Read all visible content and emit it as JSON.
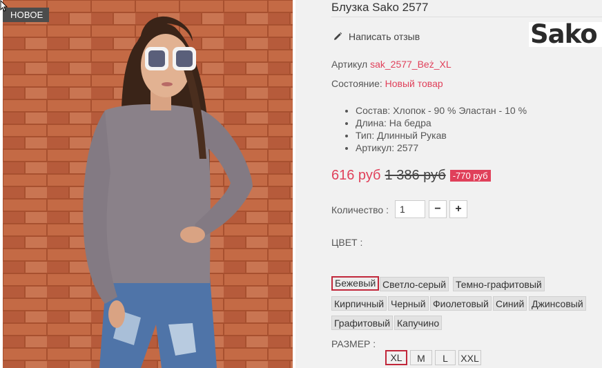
{
  "product": {
    "badge": "НОВОЕ",
    "title": "Блузка Sako 2577",
    "review_label": "Написать отзыв",
    "brand_logo_text": "Sako",
    "sku_label": "Артикул",
    "sku_value": "sak_2577_Beż_XL",
    "condition_label": "Состояние:",
    "condition_value": "Новый товар",
    "features": [
      "Состав: Хлопок - 90 % Эластан - 10 %",
      "Длина: На бедра",
      "Тип: Длинный Рукав",
      "Артикул: 2577"
    ],
    "price_new": "616 руб",
    "price_old": "1 386 руб",
    "discount": "-770 руб",
    "quantity_label": "Количество :",
    "quantity_value": "1",
    "minus_symbol": "−",
    "plus_symbol": "+",
    "color_label": "ЦВЕТ :",
    "colors": [
      "Бежевый",
      "Светло-серый",
      "Темно-графитовый",
      "Кирпичный",
      "Черный",
      "Фиолетовый",
      "Синий",
      "Джинсовый",
      "Графитовый",
      "Капучино"
    ],
    "selected_color": "Бежевый",
    "size_label": "РАЗМЕР :",
    "sizes": [
      "XL",
      "M",
      "L",
      "XXL"
    ],
    "selected_size": "XL"
  },
  "colors": {
    "accent": "#e0405a",
    "selected_border": "#c1273a",
    "badge_bg": "#4c4c4c",
    "background": "#f1f1f1"
  },
  "icons": {
    "review": "pencil-icon",
    "cursor": "mouse-cursor-icon"
  }
}
